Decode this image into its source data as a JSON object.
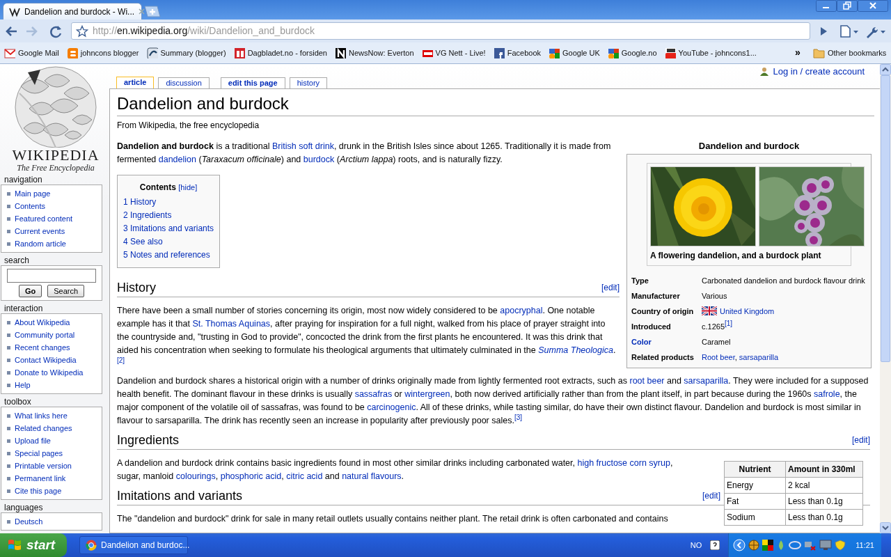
{
  "browser": {
    "tab_title": "Dandelion and burdock - Wi...",
    "address": [
      {
        "kind": "dim",
        "text": "http://"
      },
      {
        "kind": "host",
        "text": "en.wikipedia.org"
      },
      {
        "kind": "dim",
        "text": "/wiki/Dandelion_and_burdock"
      }
    ],
    "bookmarks": [
      {
        "label": "Google Mail"
      },
      {
        "label": "johncons blogger"
      },
      {
        "label": "Summary (blogger)"
      },
      {
        "label": "Dagbladet.no - forsiden"
      },
      {
        "label": "NewsNow: Everton"
      },
      {
        "label": "VG Nett - Live!"
      },
      {
        "label": "Facebook"
      },
      {
        "label": "Google UK"
      },
      {
        "label": "Google.no"
      },
      {
        "label": "YouTube - johncons1..."
      }
    ],
    "overflow": "»",
    "other_bookmarks": "Other bookmarks"
  },
  "sidebar": {
    "logo_title": "WIKIPEDIA",
    "logo_tagline": "The Free Encyclopedia",
    "portlets": [
      {
        "kind": "links",
        "heading": "navigation",
        "items": [
          "Main page",
          "Contents",
          "Featured content",
          "Current events",
          "Random article"
        ]
      },
      {
        "kind": "search",
        "heading": "search",
        "buttons": [
          "Go",
          "Search"
        ]
      },
      {
        "kind": "links",
        "heading": "interaction",
        "items": [
          "About Wikipedia",
          "Community portal",
          "Recent changes",
          "Contact Wikipedia",
          "Donate to Wikipedia",
          "Help"
        ]
      },
      {
        "kind": "links",
        "heading": "toolbox",
        "items": [
          "What links here",
          "Related changes",
          "Upload file",
          "Special pages",
          "Printable version",
          "Permanent link",
          "Cite this page"
        ]
      },
      {
        "kind": "links",
        "heading": "languages",
        "items": [
          "Deutsch"
        ]
      }
    ]
  },
  "personal": "Log in / create account",
  "tabs": [
    {
      "label": "article",
      "selected": true
    },
    {
      "label": "discussion",
      "selected": false
    },
    {
      "label": "edit this page",
      "selected": false
    },
    {
      "label": "history",
      "selected": false
    }
  ],
  "article": {
    "title": "Dandelion and burdock",
    "tagline": "From Wikipedia, the free encyclopedia",
    "intro": [
      {
        "kind": "text",
        "text": "**Dandelion and burdock** is a traditional "
      },
      {
        "kind": "link",
        "text": "British soft drink"
      },
      {
        "kind": "text",
        "text": ", drunk in the British Isles since about 1265. Traditionally it is made from fermented "
      },
      {
        "kind": "link",
        "text": "dandelion"
      },
      {
        "kind": "text",
        "text": " (*Taraxacum officinale*) and "
      },
      {
        "kind": "link",
        "text": "burdock"
      },
      {
        "kind": "text",
        "text": " (*Arctium lappa*) roots, and is naturally fizzy."
      }
    ],
    "toc": {
      "title": "Contents",
      "toggle": "[hide]",
      "items": [
        {
          "number": "1",
          "text": "History"
        },
        {
          "number": "2",
          "text": "Ingredients"
        },
        {
          "number": "3",
          "text": "Imitations and variants"
        },
        {
          "number": "4",
          "text": "See also"
        },
        {
          "number": "5",
          "text": "Notes and references"
        }
      ]
    },
    "infobox": {
      "title": "Dandelion and burdock",
      "caption": "A flowering dandelion, and a burdock plant",
      "rows": [
        {
          "label": "Type",
          "linked": false,
          "value": [
            {
              "kind": "text",
              "text": "Carbonated dandelion and burdock flavour drink"
            }
          ]
        },
        {
          "label": "Manufacturer",
          "linked": false,
          "value": [
            {
              "kind": "text",
              "text": "Various"
            }
          ]
        },
        {
          "label": "Country of origin",
          "linked": false,
          "value": [
            {
              "kind": "flag"
            },
            {
              "kind": "link",
              "text": "United Kingdom"
            }
          ]
        },
        {
          "label": "Introduced",
          "linked": false,
          "value": [
            {
              "kind": "text",
              "text": "c.1265"
            },
            {
              "kind": "ref",
              "text": "[1]"
            }
          ]
        },
        {
          "label": "Color",
          "linked": true,
          "value": [
            {
              "kind": "text",
              "text": "Caramel"
            }
          ]
        },
        {
          "label": "Related products",
          "linked": false,
          "value": [
            {
              "kind": "link",
              "text": "Root beer"
            },
            {
              "kind": "text",
              "text": ", "
            },
            {
              "kind": "link",
              "text": "sarsaparilla"
            }
          ]
        }
      ]
    },
    "sections": [
      {
        "title": "History",
        "edit": "[edit]",
        "paragraphs": [
          [
            {
              "kind": "text",
              "text": "There have been a small number of stories concerning its origin, most now widely considered to be "
            },
            {
              "kind": "link",
              "text": "apocryphal"
            },
            {
              "kind": "text",
              "text": ". One notable example has it that "
            },
            {
              "kind": "link",
              "text": "St. Thomas Aquinas"
            },
            {
              "kind": "text",
              "text": ", after praying for inspiration for a full night, walked from his place of prayer straight into the countryside and, \"trusting in God to provide\", concocted the drink from the first plants he encountered. It was this drink that aided his concentration when seeking to formulate his theological arguments that ultimately culminated in the "
            },
            {
              "kind": "italic_link",
              "text": "Summa Theologica"
            },
            {
              "kind": "text",
              "text": "."
            },
            {
              "kind": "ref",
              "text": "[2]"
            }
          ],
          [
            {
              "kind": "text",
              "text": "Dandelion and burdock shares a historical origin with a number of drinks originally made from lightly fermented root extracts, such as "
            },
            {
              "kind": "link",
              "text": "root beer"
            },
            {
              "kind": "text",
              "text": " and "
            },
            {
              "kind": "link",
              "text": "sarsaparilla"
            },
            {
              "kind": "text",
              "text": ". They were included for a supposed health benefit. The dominant flavour in these drinks is usually "
            },
            {
              "kind": "link",
              "text": "sassafras"
            },
            {
              "kind": "text",
              "text": " or "
            },
            {
              "kind": "link",
              "text": "wintergreen"
            },
            {
              "kind": "text",
              "text": ", both now derived artificially rather than from the plant itself, in part because during the 1960s "
            },
            {
              "kind": "link",
              "text": "safrole"
            },
            {
              "kind": "text",
              "text": ", the major component of the volatile oil of sassafras, was found to be "
            },
            {
              "kind": "link",
              "text": "carcinogenic"
            },
            {
              "kind": "text",
              "text": ". All of these drinks, while tasting similar, do have their own distinct flavour. Dandelion and burdock is most similar in flavour to sarsaparilla. The drink has recently seen an increase in popularity after previously poor sales."
            },
            {
              "kind": "ref",
              "text": "[3]"
            }
          ]
        ]
      },
      {
        "title": "Ingredients",
        "edit": "[edit]",
        "table": {
          "columns": [
            "Nutrient",
            "Amount in 330ml"
          ],
          "rows": [
            [
              "Energy",
              "2 kcal"
            ],
            [
              "Fat",
              "Less than 0.1g"
            ],
            [
              "Sodium",
              "Less than 0.1g"
            ]
          ]
        },
        "paragraphs": [
          [
            {
              "kind": "text",
              "text": "A dandelion and burdock drink contains basic ingredients found in most other similar drinks including carbonated water, "
            },
            {
              "kind": "link",
              "text": "high fructose corn syrup"
            },
            {
              "kind": "text",
              "text": ", sugar, manloid "
            },
            {
              "kind": "link",
              "text": "colourings"
            },
            {
              "kind": "text",
              "text": ", "
            },
            {
              "kind": "link",
              "text": "phosphoric acid"
            },
            {
              "kind": "text",
              "text": ", "
            },
            {
              "kind": "link",
              "text": "citric acid"
            },
            {
              "kind": "text",
              "text": " and "
            },
            {
              "kind": "link",
              "text": "natural flavours"
            },
            {
              "kind": "text",
              "text": "."
            }
          ]
        ]
      },
      {
        "title": "Imitations and variants",
        "edit": "[edit]",
        "paragraphs": [
          [
            {
              "kind": "text",
              "text": "The \"dandelion and burdock\" drink for sale in many retail outlets usually contains neither plant. The retail drink is often carbonated and contains"
            }
          ]
        ]
      }
    ]
  },
  "taskbar": {
    "start": "start",
    "tasks": [
      {
        "label": "Dandelion and burdoc...",
        "selected": false
      }
    ],
    "language": "NO",
    "clock": "11:21"
  }
}
